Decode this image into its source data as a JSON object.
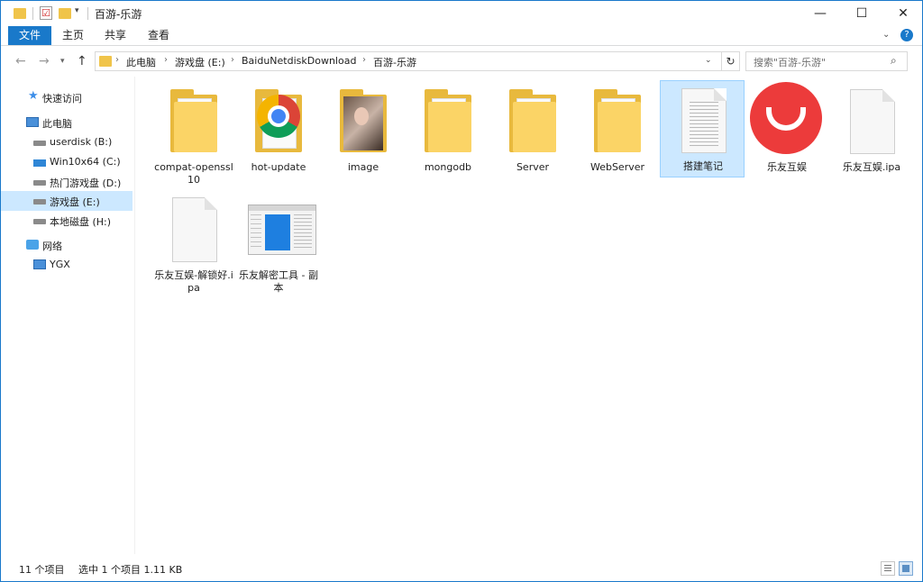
{
  "window": {
    "title": "百游-乐游",
    "minimize_glyph": "—",
    "maximize_glyph": "☐",
    "close_glyph": "✕"
  },
  "quick_access_toolbar": {
    "check_glyph": "☑",
    "dropdown_glyph": "▾"
  },
  "ribbon": {
    "tabs": [
      {
        "label": "文件"
      },
      {
        "label": "主页"
      },
      {
        "label": "共享"
      },
      {
        "label": "查看"
      }
    ],
    "expand_glyph": "⌄",
    "help_glyph": "?"
  },
  "nav": {
    "back_glyph": "←",
    "forward_glyph": "→",
    "recent_glyph": "▾",
    "up_glyph": "↑",
    "crumbs": [
      {
        "label": "此电脑"
      },
      {
        "label": "游戏盘 (E:)"
      },
      {
        "label": "BaiduNetdiskDownload"
      },
      {
        "label": "百游-乐游"
      }
    ],
    "crumb_sep_glyph": "›",
    "address_dropdown_glyph": "⌄",
    "refresh_glyph": "↻",
    "search_placeholder": "搜索\"百游-乐游\"",
    "search_glyph": "⌕"
  },
  "sidebar": {
    "items": [
      {
        "label": "快速访问",
        "icon": "star-icon"
      },
      {
        "label": "此电脑",
        "icon": "computer-icon"
      },
      {
        "label": "userdisk (B:)",
        "icon": "drive-icon"
      },
      {
        "label": "Win10x64 (C:)",
        "icon": "windows-drive-icon"
      },
      {
        "label": "热门游戏盘 (D:)",
        "icon": "drive-icon"
      },
      {
        "label": "游戏盘 (E:)",
        "icon": "drive-icon",
        "selected": true
      },
      {
        "label": "本地磁盘 (H:)",
        "icon": "drive-icon"
      },
      {
        "label": "网络",
        "icon": "network-icon"
      },
      {
        "label": "YGX",
        "icon": "computer-icon"
      }
    ]
  },
  "files": [
    {
      "name": "compat-openssl10",
      "type": "folder"
    },
    {
      "name": "hot-update",
      "type": "chrome-file"
    },
    {
      "name": "image",
      "type": "image-folder"
    },
    {
      "name": "mongodb",
      "type": "folder"
    },
    {
      "name": "Server",
      "type": "folder"
    },
    {
      "name": "WebServer",
      "type": "folder"
    },
    {
      "name": "搭建笔记",
      "type": "text-document",
      "selected": true
    },
    {
      "name": "乐友互娱",
      "type": "app-icon"
    },
    {
      "name": "乐友互娱.ipa",
      "type": "blank-file"
    },
    {
      "name": "乐友互娱-解锁好.ipa",
      "type": "blank-file"
    },
    {
      "name": "乐友解密工具 - 副本",
      "type": "app-window"
    }
  ],
  "status": {
    "item_count": "11 个项目",
    "selection": "选中 1 个项目  1.11 KB"
  }
}
